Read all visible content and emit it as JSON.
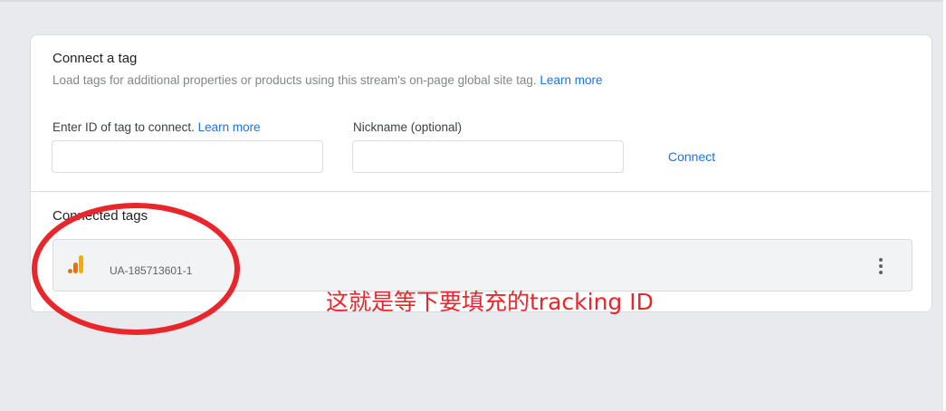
{
  "connect_section": {
    "title": "Connect a tag",
    "description": "Load tags for additional properties or products using this stream's on-page global site tag.",
    "description_link": "Learn more",
    "tag_id_label": "Enter ID of tag to connect.",
    "tag_id_link": "Learn more",
    "tag_id_value": "",
    "nickname_label": "Nickname (optional)",
    "nickname_value": "",
    "connect_button": "Connect"
  },
  "connected_section": {
    "title": "Connected tags",
    "tags": [
      {
        "id": "UA-185713601-1",
        "icon": "google-analytics-icon"
      }
    ],
    "more_icon": "more-vert-icon"
  },
  "annotation": {
    "text": "这就是等下要填充的tracking ID",
    "color": "#e8262c"
  },
  "colors": {
    "accent": "#1a73e8",
    "analytics_orange": "#f9ab00",
    "analytics_dark_orange": "#e37400",
    "annotation_red": "#e8262c"
  }
}
